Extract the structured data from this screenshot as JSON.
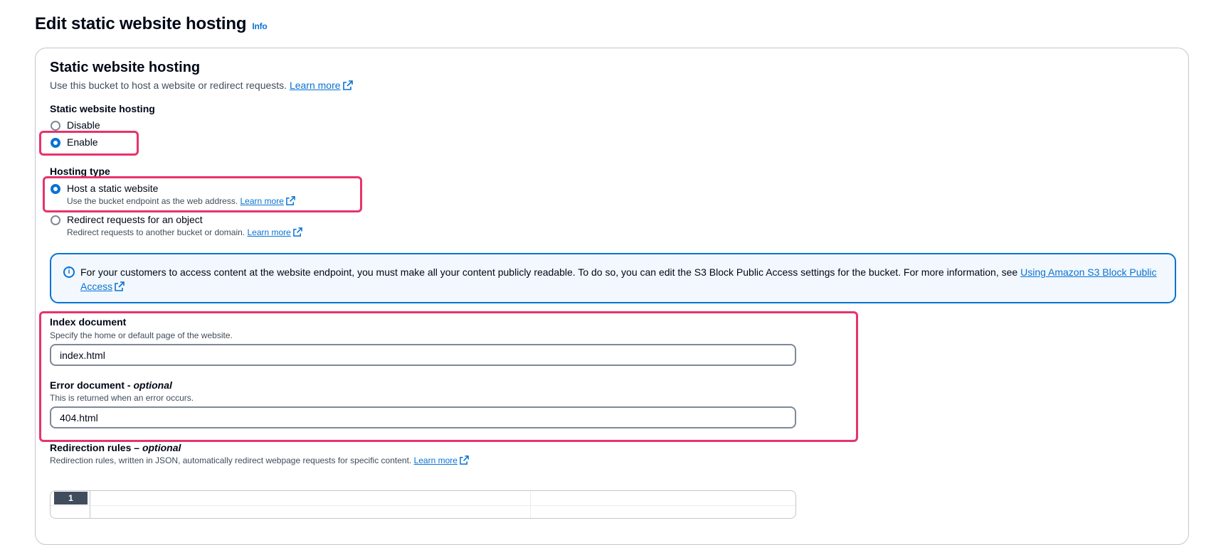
{
  "page": {
    "title": "Edit static website hosting",
    "info_link": "Info"
  },
  "panel": {
    "title": "Static website hosting",
    "description": "Use this bucket to host a website or redirect requests.",
    "learn_more": "Learn more"
  },
  "hosting_toggle": {
    "label": "Static website hosting",
    "options": [
      {
        "label": "Disable",
        "checked": false
      },
      {
        "label": "Enable",
        "checked": true
      }
    ]
  },
  "hosting_type": {
    "label": "Hosting type",
    "options": [
      {
        "label": "Host a static website",
        "description": "Use the bucket endpoint as the web address.",
        "learn_more": "Learn more",
        "checked": true
      },
      {
        "label": "Redirect requests for an object",
        "description": "Redirect requests to another bucket or domain.",
        "learn_more": "Learn more",
        "checked": false
      }
    ]
  },
  "alert": {
    "text": "For your customers to access content at the website endpoint, you must make all your content publicly readable. To do so, you can edit the S3 Block Public Access settings for the bucket. For more information, see ",
    "link": "Using Amazon S3 Block Public Access"
  },
  "index_document": {
    "label": "Index document",
    "description": "Specify the home or default page of the website.",
    "value": "index.html"
  },
  "error_document": {
    "label": "Error document - ",
    "label_optional": "optional",
    "description": "This is returned when an error occurs.",
    "value": "404.html"
  },
  "redirection_rules": {
    "label": "Redirection rules – ",
    "label_optional": "optional",
    "description": "Redirection rules, written in JSON, automatically redirect webpage requests for specific content.",
    "learn_more": "Learn more",
    "line_number": "1"
  },
  "colors": {
    "accent": "#0972d3",
    "highlight": "#e8336b",
    "alert_bg": "#f2f8fd"
  }
}
